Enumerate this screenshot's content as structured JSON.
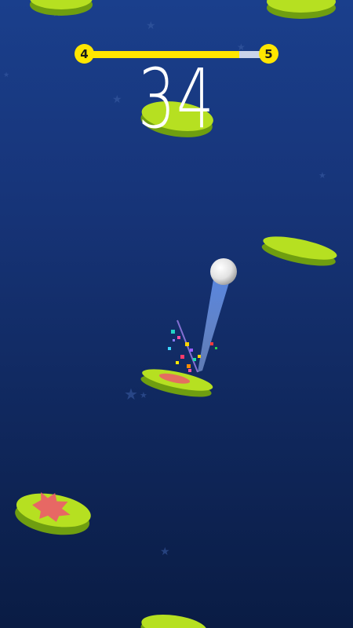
{
  "hud": {
    "current_level": "4",
    "next_level": "5",
    "level_progress": 0.84,
    "score": "34"
  },
  "colors": {
    "platform_top": "#b6e021",
    "platform_side": "#6f9e10",
    "splat": "#ec5b6b",
    "ball": "#ececec",
    "progress_fill": "#ffe600",
    "progress_track": "#c9d3ea"
  },
  "icons": {
    "ball": "ball-icon",
    "star": "star-icon"
  }
}
